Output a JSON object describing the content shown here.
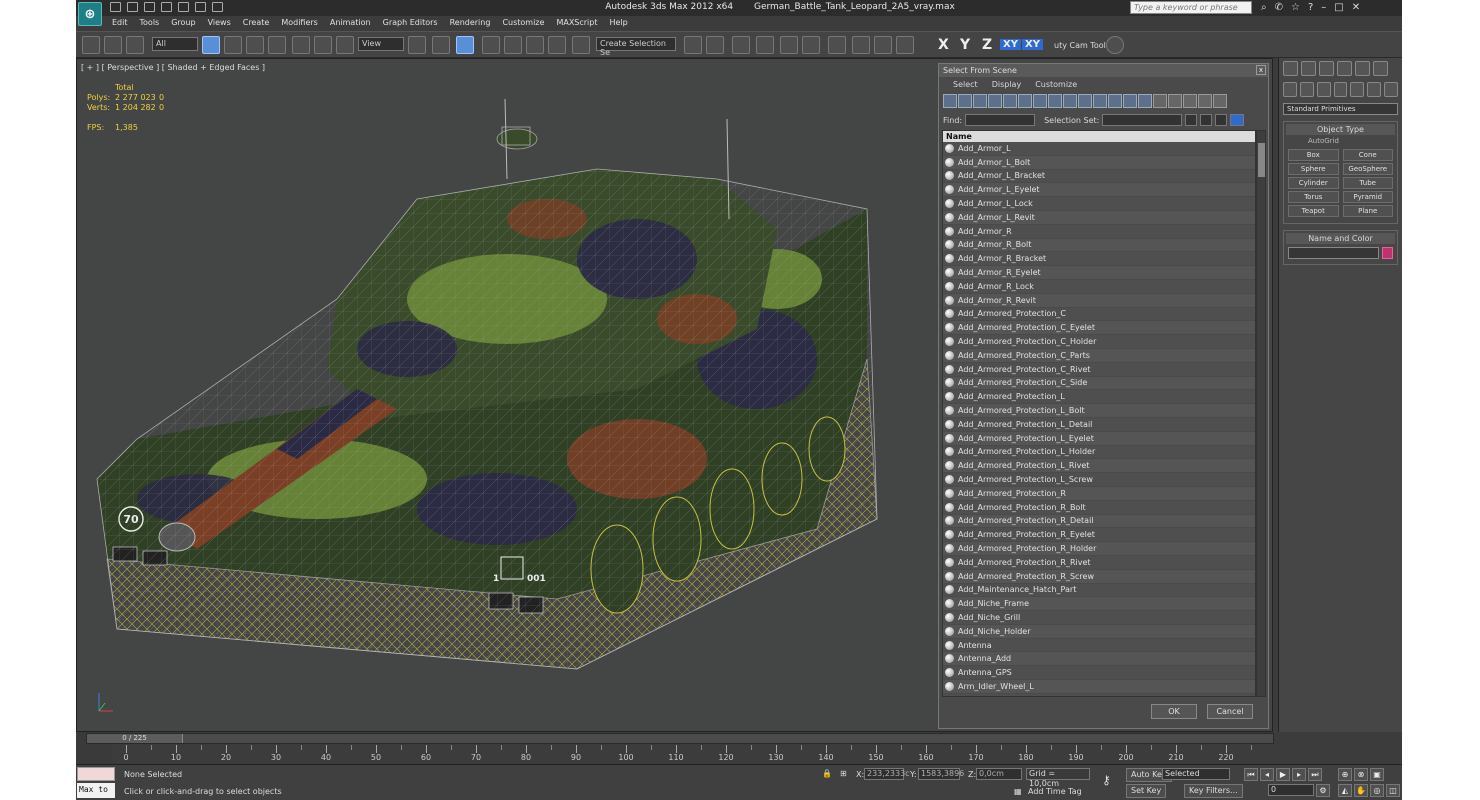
{
  "titlebar": {
    "app": "Autodesk 3ds Max  2012 x64",
    "file": "German_Battle_Tank_Leopard_2A5_vray.max",
    "search_placeholder": "Type a keyword or phrase",
    "help": "?"
  },
  "menu": [
    "Edit",
    "Tools",
    "Group",
    "Views",
    "Create",
    "Modifiers",
    "Animation",
    "Graph Editors",
    "Rendering",
    "Customize",
    "MAXScript",
    "Help"
  ],
  "toolbar": {
    "filter": "All",
    "ref_coord": "View",
    "selection_set": "Create Selection Se",
    "axes": [
      "X",
      "Y",
      "Z",
      "XY",
      "XY"
    ],
    "cam_tool": "uty Cam Tool \\"
  },
  "viewport": {
    "label": "[ + ] [ Perspective ] [ Shaded + Edged Faces ]",
    "stats": {
      "header": "Total",
      "rows": [
        {
          "label": "Polys:",
          "value": "2 277 023",
          "sel": "0"
        },
        {
          "label": "Verts:",
          "value": "1 204 282",
          "sel": "0"
        }
      ],
      "fps_label": "FPS:",
      "fps_value": "1,385"
    },
    "decals": [
      "70",
      "1",
      "001"
    ]
  },
  "select_from_scene": {
    "title": "Select From Scene",
    "close": "x",
    "tabs": [
      "Select",
      "Display",
      "Customize"
    ],
    "find_label": "Find:",
    "selset_label": "Selection Set:",
    "column": "Name",
    "items": [
      "Add_Armor_L",
      "Add_Armor_L_Bolt",
      "Add_Armor_L_Bracket",
      "Add_Armor_L_Eyelet",
      "Add_Armor_L_Lock",
      "Add_Armor_L_Revit",
      "Add_Armor_R",
      "Add_Armor_R_Bolt",
      "Add_Armor_R_Bracket",
      "Add_Armor_R_Eyelet",
      "Add_Armor_R_Lock",
      "Add_Armor_R_Revit",
      "Add_Armored_Protection_C",
      "Add_Armored_Protection_C_Eyelet",
      "Add_Armored_Protection_C_Holder",
      "Add_Armored_Protection_C_Parts",
      "Add_Armored_Protection_C_Rivet",
      "Add_Armored_Protection_C_Side",
      "Add_Armored_Protection_L",
      "Add_Armored_Protection_L_Bolt",
      "Add_Armored_Protection_L_Detail",
      "Add_Armored_Protection_L_Eyelet",
      "Add_Armored_Protection_L_Holder",
      "Add_Armored_Protection_L_Rivet",
      "Add_Armored_Protection_L_Screw",
      "Add_Armored_Protection_R",
      "Add_Armored_Protection_R_Bolt",
      "Add_Armored_Protection_R_Detail",
      "Add_Armored_Protection_R_Eyelet",
      "Add_Armored_Protection_R_Holder",
      "Add_Armored_Protection_R_Rivet",
      "Add_Armored_Protection_R_Screw",
      "Add_Maintenance_Hatch_Part",
      "Add_Niche_Frame",
      "Add_Niche_Grill",
      "Add_Niche_Holder",
      "Antenna",
      "Antenna_Add",
      "Antenna_GPS",
      "Arm_Idler_Wheel_L"
    ],
    "ok": "OK",
    "cancel": "Cancel"
  },
  "command_panel": {
    "category": "Standard Primitives",
    "object_type_title": "Object Type",
    "autogrid": "AutoGrid",
    "primitives": [
      "Box",
      "Cone",
      "Sphere",
      "GeoSphere",
      "Cylinder",
      "Tube",
      "Torus",
      "Pyramid",
      "Teapot",
      "Plane"
    ],
    "name_color_title": "Name and Color",
    "object_color": "#c0326e"
  },
  "timeline": {
    "slider": "0 / 225",
    "ticks": [
      "0",
      "10",
      "20",
      "30",
      "40",
      "50",
      "60",
      "70",
      "80",
      "90",
      "100",
      "110",
      "120",
      "130",
      "140",
      "150",
      "160",
      "170",
      "180",
      "190",
      "200",
      "210",
      "220"
    ]
  },
  "status": {
    "maxscript": "Max to",
    "selection": "None Selected",
    "prompt": "Click or click-and-drag to select objects",
    "x_label": "X:",
    "x_value": "233,2333c",
    "y_label": "Y:",
    "y_value": "1583,3896",
    "z_label": "Z:",
    "z_value": "0,0cm",
    "grid": "Grid = 10,0cm",
    "add_time_tag": "Add Time Tag",
    "auto_key": "Auto Key",
    "set_key": "Set Key",
    "key_mode": "Selected",
    "key_filters": "Key Filters...",
    "frame": "0"
  }
}
